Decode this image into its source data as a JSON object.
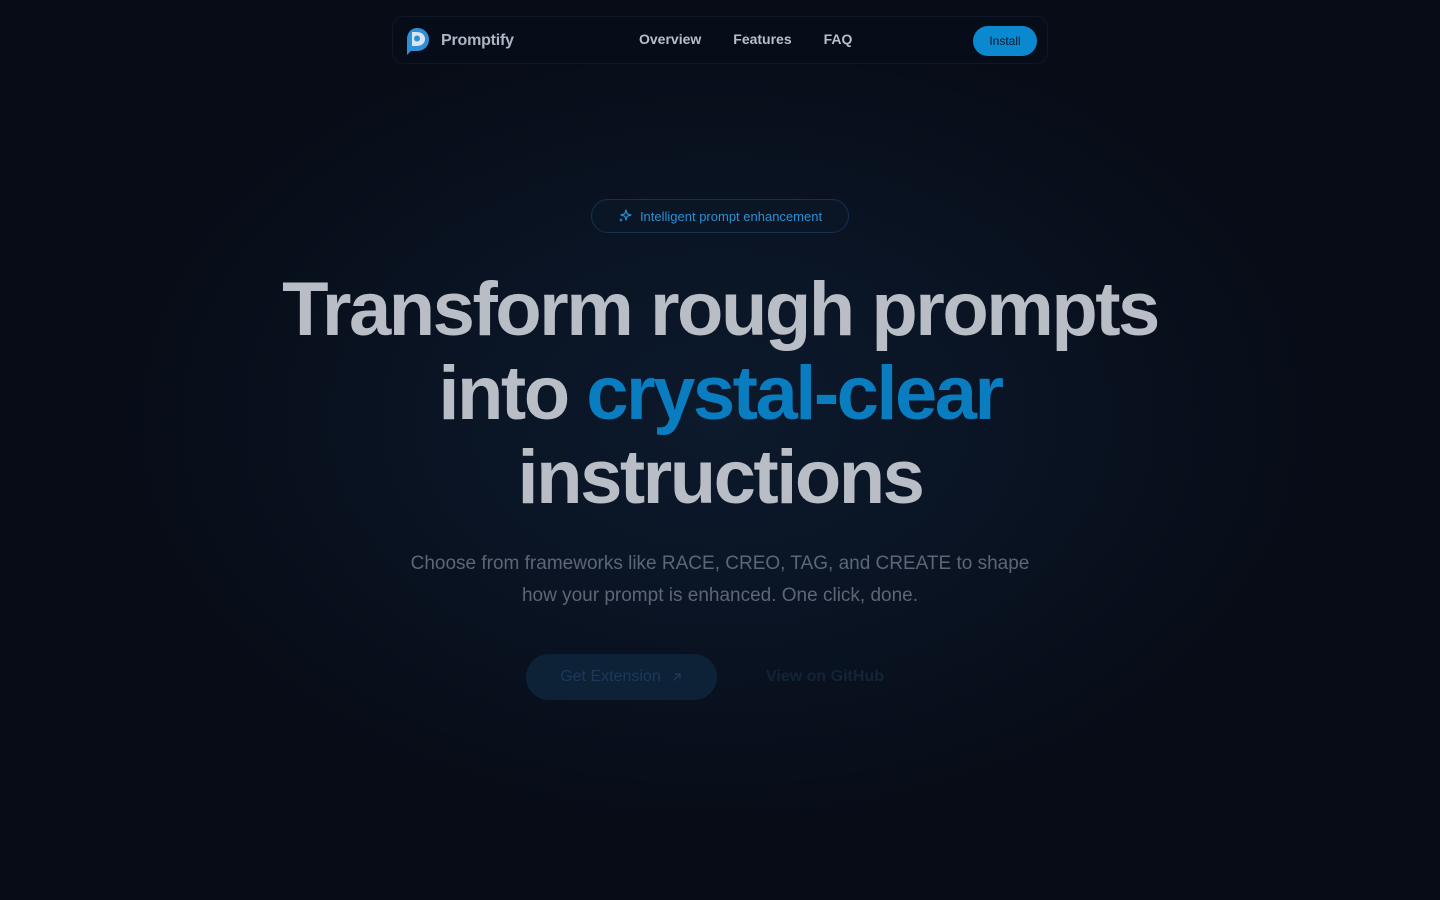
{
  "brand": {
    "name": "Promptify",
    "logo_icon": "speech-bubble-p-icon"
  },
  "nav": {
    "links": [
      "Overview",
      "Features",
      "FAQ"
    ],
    "install_label": "Install"
  },
  "hero": {
    "badge_icon": "sparkles-icon",
    "badge_text": "Intelligent prompt enhancement",
    "headline_line1": "Transform rough prompts",
    "headline_line2_prefix": "into ",
    "headline_accent": "crystal-clear",
    "headline_line3": "instructions",
    "subtitle_line1": "Choose from frameworks like RACE, CREO, TAG, and CREATE to shape",
    "subtitle_line2": "how your prompt is enhanced. One click, done.",
    "primary_cta": "Get Extension",
    "primary_cta_icon": "external-arrow-icon",
    "secondary_cta": "View on GitHub"
  },
  "colors": {
    "background": "#070c16",
    "accent": "#0a7cc0",
    "install_button": "#0b89d0"
  }
}
